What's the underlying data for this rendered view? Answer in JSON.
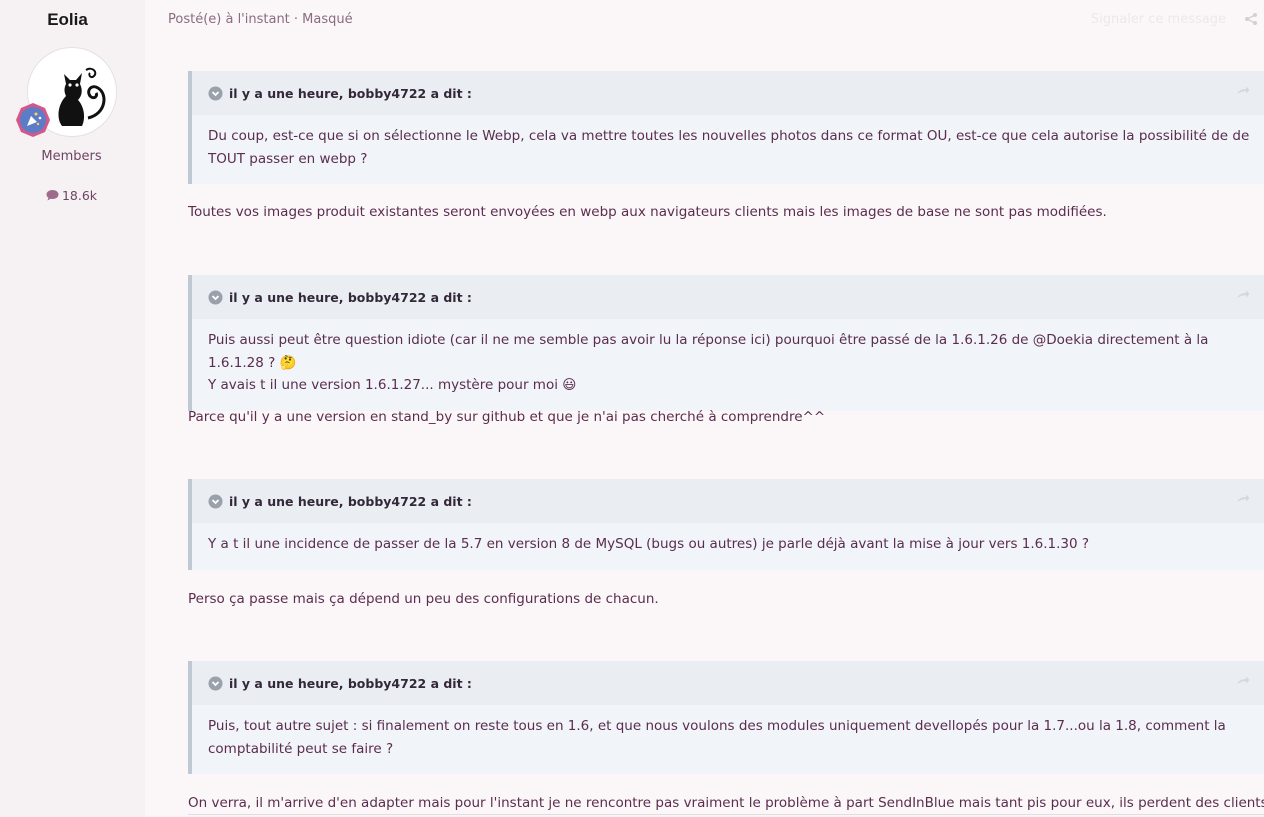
{
  "author": {
    "name": "Eolia",
    "role": "Members",
    "post_count": "18.6k"
  },
  "post": {
    "meta": "Posté(e) à l'instant · Masqué",
    "report_label": "Signaler ce message"
  },
  "colors": {
    "text": "#5a2d4f",
    "quote_border": "#bfc9d4",
    "quote_header_bg": "#eaeef2",
    "badge": "#5d7cc8"
  },
  "icons": {
    "share": "share-icon",
    "chevron": "chevron-down-circle-icon",
    "reply": "reply-arrow-icon",
    "comment": "comment-bubble-icon"
  },
  "blocks": [
    {
      "quote_header": "il y a une heure, bobby4722 a dit :",
      "quote_lines": [
        "Du coup, est-ce que si on sélectionne le Webp, cela va mettre toutes les nouvelles photos dans ce format OU, est-ce que cela autorise la possibilité de de",
        "TOUT passer en webp ?"
      ],
      "answer": "Toutes vos images produit existantes seront envoyées en webp aux navigateurs clients mais les images de base ne sont pas modifiées."
    },
    {
      "quote_header": "il y a une heure, bobby4722 a dit :",
      "quote_lines": [
        "Puis aussi peut être question idiote (car il ne me semble pas avoir lu la réponse ici) pourquoi être passé de la 1.6.1.26 de @Doekia directement à la 1.6.1.28 ? 🤔",
        "Y avais t il une version 1.6.1.27... mystère pour moi 😃"
      ],
      "answer": "Parce qu'il y a une version en stand_by sur github et que je n'ai pas cherché à comprendre^^"
    },
    {
      "quote_header": "il y a une heure, bobby4722 a dit :",
      "quote_lines": [
        "Y a t il une incidence de passer de la 5.7 en version 8 de MySQL (bugs ou autres) je parle déjà avant la mise à jour vers 1.6.1.30 ?"
      ],
      "answer": "Perso ça passe mais ça dépend un peu des configurations de chacun."
    },
    {
      "quote_header": "il y a une heure, bobby4722 a dit :",
      "quote_lines": [
        "Puis, tout autre sujet : si finalement on reste tous en 1.6, et que nous voulons des modules uniquement devellopés pour la 1.7...ou la 1.8, comment la",
        "comptabilité peut se faire ?"
      ],
      "answer": "On verra, il m'arrive d'en adapter mais pour l'instant je ne rencontre pas vraiment le problème à part SendInBlue mais tant pis pour eux, ils perdent des clients."
    }
  ]
}
